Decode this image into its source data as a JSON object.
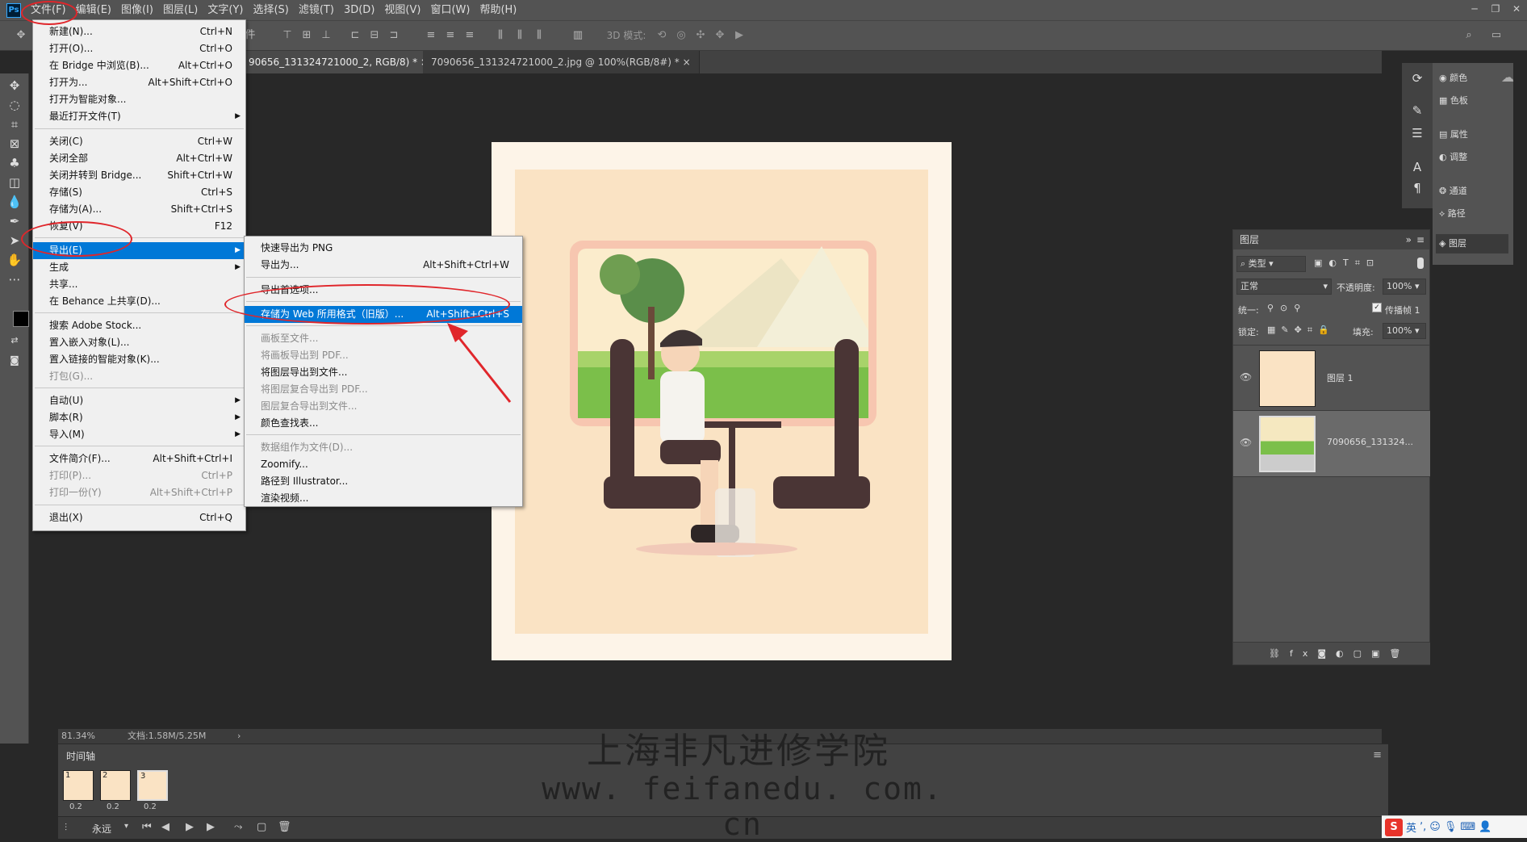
{
  "menubar": {
    "items": [
      "文件(F)",
      "编辑(E)",
      "图像(I)",
      "图层(L)",
      "文字(Y)",
      "选择(S)",
      "滤镜(T)",
      "3D(D)",
      "视图(V)",
      "窗口(W)",
      "帮助(H)"
    ],
    "logo": "Ps"
  },
  "optbar": {
    "mode3d": "3D 模式:",
    "partial_tab_text": "件"
  },
  "tabs": [
    {
      "label": "90656_131324721000_2, RGB/8) *",
      "close": "×"
    },
    {
      "label": "7090656_131324721000_2.jpg @ 100%(RGB/8#) *",
      "close": "×"
    }
  ],
  "file_menu": {
    "items": [
      {
        "label": "新建(N)...",
        "shortcut": "Ctrl+N"
      },
      {
        "label": "打开(O)...",
        "shortcut": "Ctrl+O"
      },
      {
        "label": "在 Bridge 中浏览(B)...",
        "shortcut": "Alt+Ctrl+O"
      },
      {
        "label": "打开为...",
        "shortcut": "Alt+Shift+Ctrl+O"
      },
      {
        "label": "打开为智能对象...",
        "shortcut": ""
      },
      {
        "label": "最近打开文件(T)",
        "shortcut": ""
      },
      {
        "label": "关闭(C)",
        "shortcut": "Ctrl+W"
      },
      {
        "label": "关闭全部",
        "shortcut": "Alt+Ctrl+W"
      },
      {
        "label": "关闭并转到 Bridge...",
        "shortcut": "Shift+Ctrl+W"
      },
      {
        "label": "存储(S)",
        "shortcut": "Ctrl+S"
      },
      {
        "label": "存储为(A)...",
        "shortcut": "Shift+Ctrl+S"
      },
      {
        "label": "恢复(V)",
        "shortcut": "F12"
      },
      {
        "label": "导出(E)",
        "shortcut": ""
      },
      {
        "label": "生成",
        "shortcut": ""
      },
      {
        "label": "共享...",
        "shortcut": ""
      },
      {
        "label": "在 Behance 上共享(D)...",
        "shortcut": ""
      },
      {
        "label": "搜索 Adobe Stock...",
        "shortcut": ""
      },
      {
        "label": "置入嵌入对象(L)...",
        "shortcut": ""
      },
      {
        "label": "置入链接的智能对象(K)...",
        "shortcut": ""
      },
      {
        "label": "打包(G)...",
        "shortcut": ""
      },
      {
        "label": "自动(U)",
        "shortcut": ""
      },
      {
        "label": "脚本(R)",
        "shortcut": ""
      },
      {
        "label": "导入(M)",
        "shortcut": ""
      },
      {
        "label": "文件简介(F)...",
        "shortcut": "Alt+Shift+Ctrl+I"
      },
      {
        "label": "打印(P)...",
        "shortcut": "Ctrl+P"
      },
      {
        "label": "打印一份(Y)",
        "shortcut": "Alt+Shift+Ctrl+P"
      },
      {
        "label": "退出(X)",
        "shortcut": "Ctrl+Q"
      }
    ]
  },
  "export_menu": {
    "items": [
      {
        "label": "快速导出为 PNG",
        "shortcut": ""
      },
      {
        "label": "导出为...",
        "shortcut": "Alt+Shift+Ctrl+W"
      },
      {
        "label": "导出首选项...",
        "shortcut": ""
      },
      {
        "label": "存储为 Web 所用格式（旧版）...",
        "shortcut": "Alt+Shift+Ctrl+S"
      },
      {
        "label": "画板至文件...",
        "shortcut": ""
      },
      {
        "label": "将画板导出到 PDF...",
        "shortcut": ""
      },
      {
        "label": "将图层导出到文件...",
        "shortcut": ""
      },
      {
        "label": "将图层复合导出到 PDF...",
        "shortcut": ""
      },
      {
        "label": "图层复合导出到文件...",
        "shortcut": ""
      },
      {
        "label": "颜色查找表...",
        "shortcut": ""
      },
      {
        "label": "数据组作为文件(D)...",
        "shortcut": ""
      },
      {
        "label": "Zoomify...",
        "shortcut": ""
      },
      {
        "label": "路径到 Illustrator...",
        "shortcut": ""
      },
      {
        "label": "渲染视频...",
        "shortcut": ""
      }
    ]
  },
  "right_panels": {
    "color": "颜色",
    "swatches": "色板",
    "properties": "属性",
    "adjustments": "调整",
    "channels": "通道",
    "paths": "路径",
    "layers": "图层"
  },
  "layers_panel": {
    "title": "图层",
    "filter": "类型",
    "blend": "正常",
    "opacity_label": "不透明度:",
    "opacity": "100%",
    "unify_label": "统一:",
    "propagate": "传播帧 1",
    "lock_label": "锁定:",
    "fill_label": "填充:",
    "fill": "100%",
    "layers": [
      {
        "name": "图层 1"
      },
      {
        "name": "7090656_131324..."
      }
    ]
  },
  "status": {
    "zoom": "81.34%",
    "doc": "文档:1.58M/5.25M"
  },
  "timeline": {
    "title": "时间轴",
    "frames": [
      {
        "num": "1",
        "delay": "0.2"
      },
      {
        "num": "2",
        "delay": "0.2"
      },
      {
        "num": "3",
        "delay": "0.2"
      }
    ],
    "loop": "永远"
  },
  "watermark": {
    "line1": "上海非凡进修学院",
    "line2": "www. feifanedu. com. cn"
  },
  "ime": {
    "logo": "S",
    "lang": "英"
  },
  "colors": {
    "highlight": "#0078d7",
    "annotation": "#e0262b"
  }
}
